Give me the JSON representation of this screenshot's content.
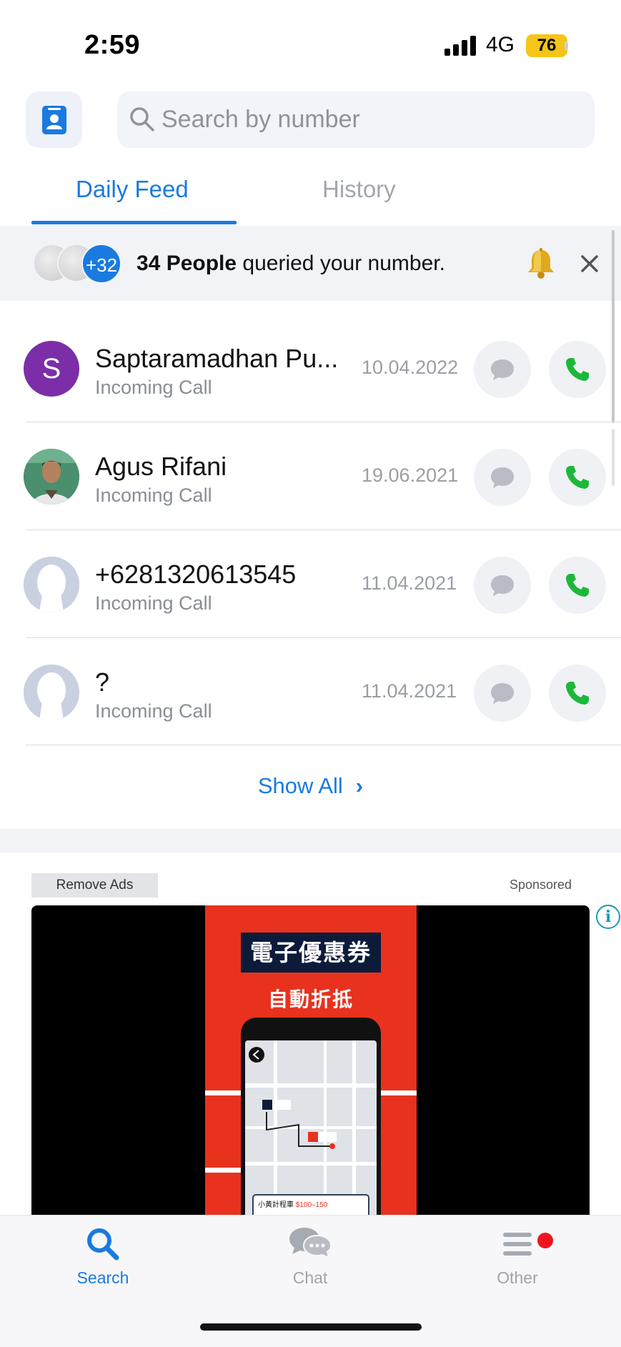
{
  "status_bar": {
    "time": "2:59",
    "network": "4G",
    "battery": "76"
  },
  "header": {
    "contact_icon": "contact-book-icon",
    "search": {
      "placeholder": "Search by number",
      "value": ""
    }
  },
  "tabs": [
    {
      "label": "Daily Feed",
      "active": true
    },
    {
      "label": "History",
      "active": false
    }
  ],
  "banner": {
    "extra_count": "+32",
    "count_text": "34 People",
    "message": " queried your number."
  },
  "calls": [
    {
      "avatar_letter": "S",
      "name": "Saptaramadhan Pu...",
      "type": "Incoming Call",
      "date": "10.04.2022"
    },
    {
      "avatar_letter": "",
      "name": "Agus Rifani",
      "type": "Incoming Call",
      "date": "19.06.2021"
    },
    {
      "avatar_letter": "",
      "name": "+6281320613545",
      "type": "Incoming Call",
      "date": "11.04.2021"
    },
    {
      "avatar_letter": "",
      "name": "?",
      "type": "Incoming Call",
      "date": "11.04.2021"
    }
  ],
  "show_all": "Show All",
  "ad": {
    "remove_label": "Remove Ads",
    "sponsored_label": "Sponsored",
    "title": "電子優惠券",
    "subtitle": "自動折抵",
    "card_text": "小黃計程車",
    "card_price": "$100–150"
  },
  "bottom_nav": [
    {
      "label": "Search",
      "icon": "search-icon",
      "active": true
    },
    {
      "label": "Chat",
      "icon": "chat-icon",
      "active": false
    },
    {
      "label": "Other",
      "icon": "menu-icon",
      "active": false
    }
  ],
  "colors": {
    "accent": "#1a7ae0",
    "call_green": "#1bb83a",
    "badge_red": "#f0141e",
    "battery": "#f5c518"
  }
}
